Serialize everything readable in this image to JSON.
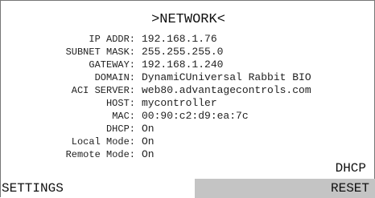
{
  "title": ">NETWORK<",
  "fields": [
    {
      "label": "IP ADDR:",
      "value": "192.168.1.76"
    },
    {
      "label": "SUBNET MASK:",
      "value": "255.255.255.0"
    },
    {
      "label": "GATEWAY:",
      "value": "192.168.1.240"
    },
    {
      "label": "DOMAIN:",
      "value": "DynamiCUniversal Rabbit BIO"
    },
    {
      "label": "ACI SERVER:",
      "value": "web80.advantagecontrols.com"
    },
    {
      "label": "HOST:",
      "value": "mycontroller"
    },
    {
      "label": "MAC:",
      "value": "00:90:c2:d9:ea:7c"
    },
    {
      "label": "DHCP:",
      "value": "On"
    },
    {
      "label": "Local Mode:",
      "value": "On"
    },
    {
      "label": "Remote Mode:",
      "value": "On"
    }
  ],
  "softkeys": {
    "dhcp": "DHCP",
    "settings": "SETTINGS",
    "reset": "RESET"
  },
  "colors": {
    "background": "#ffffff",
    "text": "#111111",
    "reset_key_background": "#c4c4c4",
    "border": "#777777"
  }
}
